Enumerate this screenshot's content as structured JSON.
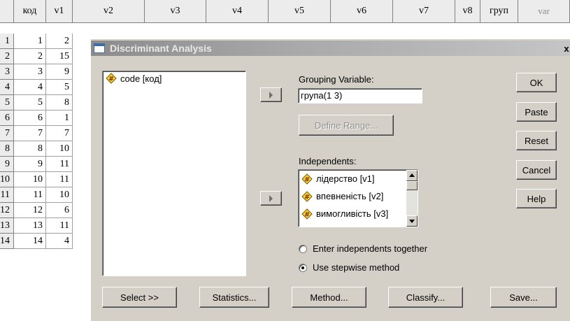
{
  "spreadsheet": {
    "columns": [
      "код",
      "v1",
      "v2",
      "v3",
      "v4",
      "v5",
      "v6",
      "v7",
      "v8",
      "груп",
      "var"
    ],
    "rows": [
      {
        "num": "1",
        "code": "1",
        "v1": "2"
      },
      {
        "num": "2",
        "code": "2",
        "v1": "15"
      },
      {
        "num": "3",
        "code": "3",
        "v1": "9"
      },
      {
        "num": "4",
        "code": "4",
        "v1": "5"
      },
      {
        "num": "5",
        "code": "5",
        "v1": "8"
      },
      {
        "num": "6",
        "code": "6",
        "v1": "1"
      },
      {
        "num": "7",
        "code": "7",
        "v1": "7"
      },
      {
        "num": "8",
        "code": "8",
        "v1": "10"
      },
      {
        "num": "9",
        "code": "9",
        "v1": "11"
      },
      {
        "num": "10",
        "code": "10",
        "v1": "11"
      },
      {
        "num": "11",
        "code": "11",
        "v1": "10"
      },
      {
        "num": "12",
        "code": "12",
        "v1": "6"
      },
      {
        "num": "13",
        "code": "13",
        "v1": "11"
      },
      {
        "num": "14",
        "code": "14",
        "v1": "4"
      }
    ]
  },
  "dialog": {
    "title": "Discriminant Analysis",
    "close_label": "x",
    "source_variables": [
      "code [код]"
    ],
    "grouping": {
      "label": "Grouping Variable:",
      "value": "група(1 3)",
      "define_range_label": "Define Range..."
    },
    "independents": {
      "label": "Independents:",
      "items": [
        "лідерство [v1]",
        "впевненість [v2]",
        "вимогливість [v3]"
      ]
    },
    "method_options": [
      {
        "label": "Enter independents together",
        "checked": false
      },
      {
        "label": "Use stepwise method",
        "checked": true
      }
    ],
    "side_buttons": [
      "OK",
      "Paste",
      "Reset",
      "Cancel",
      "Help"
    ],
    "bottom_buttons": [
      "Select >>",
      "Statistics...",
      "Method...",
      "Classify...",
      "Save..."
    ],
    "icon": "numeric-variable-icon",
    "colors": {
      "dialog_bg": "#d4d0c8",
      "titlebar": "#a8a8a8",
      "icon_fill": "#f5d23a",
      "icon_outline": "#7a5a00"
    }
  }
}
